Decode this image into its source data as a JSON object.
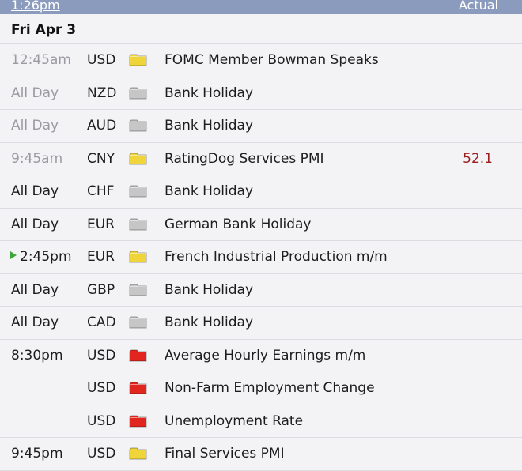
{
  "header": {
    "time_label": "1:26pm",
    "actual_label": "Actual"
  },
  "date_label": "Fri Apr 3",
  "impact_colors": {
    "low": "#f0d53a",
    "holiday": "#c6c6c6",
    "high": "#e0261e"
  },
  "rows": [
    {
      "time": "12:45am",
      "time_muted": true,
      "currency": "USD",
      "impact": "low",
      "event": "FOMC Member Bowman Speaks",
      "actual": ""
    },
    {
      "time": "All Day",
      "time_muted": true,
      "currency": "NZD",
      "impact": "holiday",
      "event": "Bank Holiday",
      "actual": ""
    },
    {
      "time": "All Day",
      "time_muted": true,
      "currency": "AUD",
      "impact": "holiday",
      "event": "Bank Holiday",
      "actual": ""
    },
    {
      "time": "9:45am",
      "time_muted": true,
      "currency": "CNY",
      "impact": "low",
      "event": "RatingDog Services PMI",
      "actual": "52.1"
    },
    {
      "time": "All Day",
      "time_muted": false,
      "currency": "CHF",
      "impact": "holiday",
      "event": "Bank Holiday",
      "actual": ""
    },
    {
      "time": "All Day",
      "time_muted": false,
      "currency": "EUR",
      "impact": "holiday",
      "event": "German Bank Holiday",
      "actual": ""
    },
    {
      "time": "2:45pm",
      "time_muted": false,
      "next_up": true,
      "currency": "EUR",
      "impact": "low",
      "event": "French Industrial Production m/m",
      "actual": ""
    },
    {
      "time": "All Day",
      "time_muted": false,
      "currency": "GBP",
      "impact": "holiday",
      "event": "Bank Holiday",
      "actual": ""
    },
    {
      "time": "All Day",
      "time_muted": false,
      "currency": "CAD",
      "impact": "holiday",
      "event": "Bank Holiday",
      "actual": ""
    },
    {
      "time": "8:30pm",
      "time_muted": false,
      "currency": "USD",
      "impact": "high",
      "event": "Average Hourly Earnings m/m",
      "actual": "",
      "grouped": true
    },
    {
      "time": "",
      "time_muted": false,
      "currency": "USD",
      "impact": "high",
      "event": "Non-Farm Employment Change",
      "actual": "",
      "grouped": true
    },
    {
      "time": "",
      "time_muted": false,
      "currency": "USD",
      "impact": "high",
      "event": "Unemployment Rate",
      "actual": ""
    },
    {
      "time": "9:45pm",
      "time_muted": false,
      "currency": "USD",
      "impact": "low",
      "event": "Final Services PMI",
      "actual": ""
    }
  ]
}
